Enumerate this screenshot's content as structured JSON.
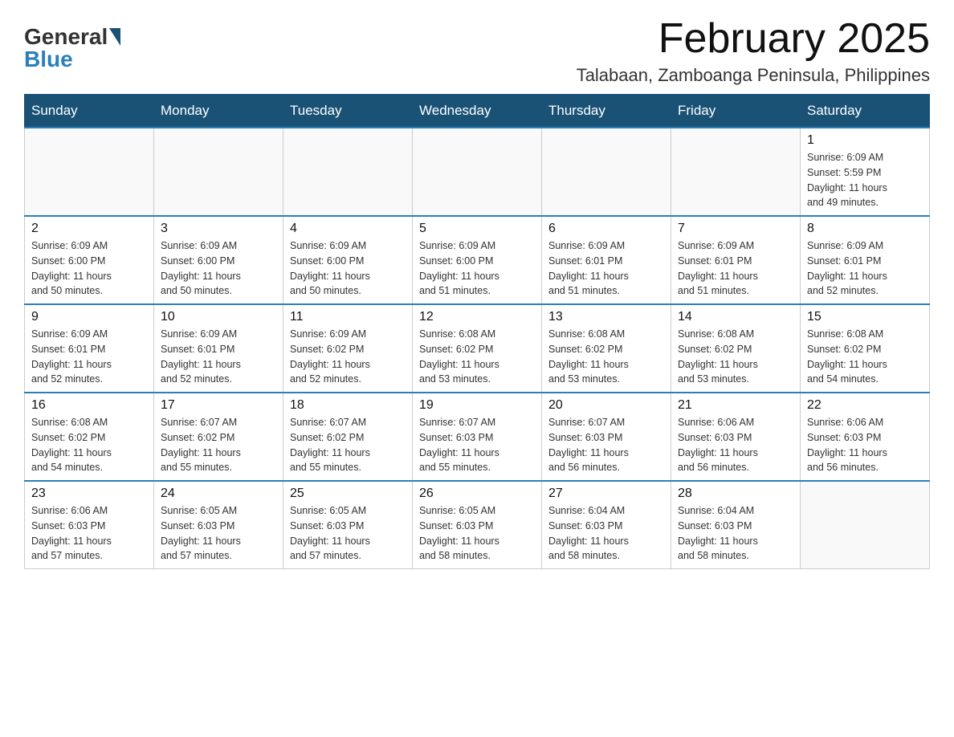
{
  "header": {
    "logo_general": "General",
    "logo_blue": "Blue",
    "month_title": "February 2025",
    "location": "Talabaan, Zamboanga Peninsula, Philippines"
  },
  "weekdays": [
    "Sunday",
    "Monday",
    "Tuesday",
    "Wednesday",
    "Thursday",
    "Friday",
    "Saturday"
  ],
  "weeks": [
    [
      {
        "day": "",
        "info": ""
      },
      {
        "day": "",
        "info": ""
      },
      {
        "day": "",
        "info": ""
      },
      {
        "day": "",
        "info": ""
      },
      {
        "day": "",
        "info": ""
      },
      {
        "day": "",
        "info": ""
      },
      {
        "day": "1",
        "info": "Sunrise: 6:09 AM\nSunset: 5:59 PM\nDaylight: 11 hours\nand 49 minutes."
      }
    ],
    [
      {
        "day": "2",
        "info": "Sunrise: 6:09 AM\nSunset: 6:00 PM\nDaylight: 11 hours\nand 50 minutes."
      },
      {
        "day": "3",
        "info": "Sunrise: 6:09 AM\nSunset: 6:00 PM\nDaylight: 11 hours\nand 50 minutes."
      },
      {
        "day": "4",
        "info": "Sunrise: 6:09 AM\nSunset: 6:00 PM\nDaylight: 11 hours\nand 50 minutes."
      },
      {
        "day": "5",
        "info": "Sunrise: 6:09 AM\nSunset: 6:00 PM\nDaylight: 11 hours\nand 51 minutes."
      },
      {
        "day": "6",
        "info": "Sunrise: 6:09 AM\nSunset: 6:01 PM\nDaylight: 11 hours\nand 51 minutes."
      },
      {
        "day": "7",
        "info": "Sunrise: 6:09 AM\nSunset: 6:01 PM\nDaylight: 11 hours\nand 51 minutes."
      },
      {
        "day": "8",
        "info": "Sunrise: 6:09 AM\nSunset: 6:01 PM\nDaylight: 11 hours\nand 52 minutes."
      }
    ],
    [
      {
        "day": "9",
        "info": "Sunrise: 6:09 AM\nSunset: 6:01 PM\nDaylight: 11 hours\nand 52 minutes."
      },
      {
        "day": "10",
        "info": "Sunrise: 6:09 AM\nSunset: 6:01 PM\nDaylight: 11 hours\nand 52 minutes."
      },
      {
        "day": "11",
        "info": "Sunrise: 6:09 AM\nSunset: 6:02 PM\nDaylight: 11 hours\nand 52 minutes."
      },
      {
        "day": "12",
        "info": "Sunrise: 6:08 AM\nSunset: 6:02 PM\nDaylight: 11 hours\nand 53 minutes."
      },
      {
        "day": "13",
        "info": "Sunrise: 6:08 AM\nSunset: 6:02 PM\nDaylight: 11 hours\nand 53 minutes."
      },
      {
        "day": "14",
        "info": "Sunrise: 6:08 AM\nSunset: 6:02 PM\nDaylight: 11 hours\nand 53 minutes."
      },
      {
        "day": "15",
        "info": "Sunrise: 6:08 AM\nSunset: 6:02 PM\nDaylight: 11 hours\nand 54 minutes."
      }
    ],
    [
      {
        "day": "16",
        "info": "Sunrise: 6:08 AM\nSunset: 6:02 PM\nDaylight: 11 hours\nand 54 minutes."
      },
      {
        "day": "17",
        "info": "Sunrise: 6:07 AM\nSunset: 6:02 PM\nDaylight: 11 hours\nand 55 minutes."
      },
      {
        "day": "18",
        "info": "Sunrise: 6:07 AM\nSunset: 6:02 PM\nDaylight: 11 hours\nand 55 minutes."
      },
      {
        "day": "19",
        "info": "Sunrise: 6:07 AM\nSunset: 6:03 PM\nDaylight: 11 hours\nand 55 minutes."
      },
      {
        "day": "20",
        "info": "Sunrise: 6:07 AM\nSunset: 6:03 PM\nDaylight: 11 hours\nand 56 minutes."
      },
      {
        "day": "21",
        "info": "Sunrise: 6:06 AM\nSunset: 6:03 PM\nDaylight: 11 hours\nand 56 minutes."
      },
      {
        "day": "22",
        "info": "Sunrise: 6:06 AM\nSunset: 6:03 PM\nDaylight: 11 hours\nand 56 minutes."
      }
    ],
    [
      {
        "day": "23",
        "info": "Sunrise: 6:06 AM\nSunset: 6:03 PM\nDaylight: 11 hours\nand 57 minutes."
      },
      {
        "day": "24",
        "info": "Sunrise: 6:05 AM\nSunset: 6:03 PM\nDaylight: 11 hours\nand 57 minutes."
      },
      {
        "day": "25",
        "info": "Sunrise: 6:05 AM\nSunset: 6:03 PM\nDaylight: 11 hours\nand 57 minutes."
      },
      {
        "day": "26",
        "info": "Sunrise: 6:05 AM\nSunset: 6:03 PM\nDaylight: 11 hours\nand 58 minutes."
      },
      {
        "day": "27",
        "info": "Sunrise: 6:04 AM\nSunset: 6:03 PM\nDaylight: 11 hours\nand 58 minutes."
      },
      {
        "day": "28",
        "info": "Sunrise: 6:04 AM\nSunset: 6:03 PM\nDaylight: 11 hours\nand 58 minutes."
      },
      {
        "day": "",
        "info": ""
      }
    ]
  ]
}
